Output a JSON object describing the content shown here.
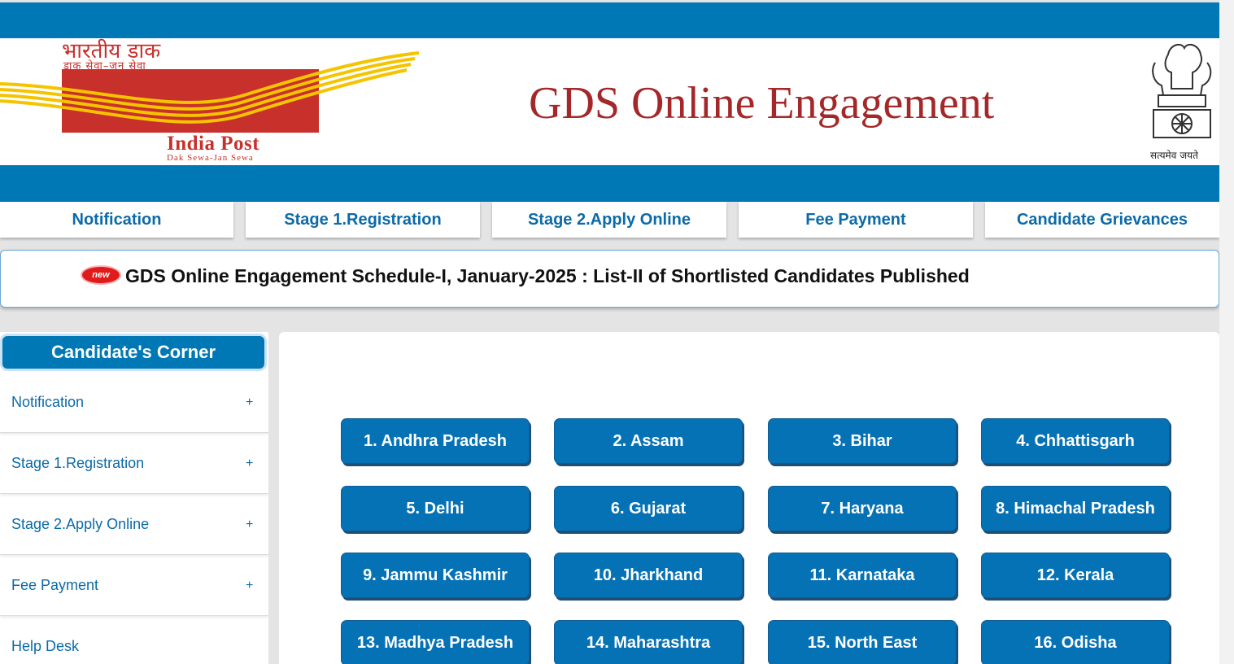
{
  "header": {
    "logo_hindi": "भारतीय डाक",
    "logo_hindi_sub": "डाक सेवा–जन सेवा",
    "logo_english": "India Post",
    "logo_english_sub": "Dak Sewa-Jan Sewa",
    "site_title": "GDS Online Engagement",
    "emblem_motto": "सत्यमेव जयते"
  },
  "nav": {
    "items": [
      {
        "label": "Notification"
      },
      {
        "label": "Stage 1.Registration"
      },
      {
        "label": "Stage 2.Apply Online"
      },
      {
        "label": "Fee Payment"
      },
      {
        "label": "Candidate Grievances"
      }
    ]
  },
  "ticker": {
    "badge": "new",
    "text": "GDS Online Engagement Schedule-I, January-2025 : List-II of Shortlisted Candidates Published"
  },
  "sidebar": {
    "title": "Candidate's Corner",
    "expand_symbol": "+",
    "items": [
      {
        "label": "Notification"
      },
      {
        "label": "Stage 1.Registration"
      },
      {
        "label": "Stage 2.Apply Online"
      },
      {
        "label": "Fee Payment"
      },
      {
        "label": "Help Desk"
      }
    ]
  },
  "states": [
    "1. Andhra Pradesh",
    "2. Assam",
    "3. Bihar",
    "4. Chhattisgarh",
    "5. Delhi",
    "6. Gujarat",
    "7. Haryana",
    "8. Himachal Pradesh",
    "9. Jammu Kashmir",
    "10. Jharkhand",
    "11. Karnataka",
    "12. Kerala",
    "13. Madhya Pradesh",
    "14. Maharashtra",
    "15. North East",
    "16. Odisha"
  ],
  "colors": {
    "brand_blue": "#0078b6",
    "title_red": "#a4282a",
    "logo_red": "#c8302c",
    "logo_yellow": "#f5c400"
  }
}
